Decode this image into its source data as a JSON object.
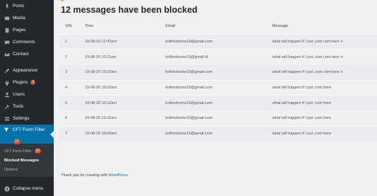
{
  "sidebar": {
    "items": [
      {
        "label": "Posts",
        "icon": "pin-icon"
      },
      {
        "label": "Media",
        "icon": "media-icon"
      },
      {
        "label": "Pages",
        "icon": "pages-icon"
      },
      {
        "label": "Comments",
        "icon": "comments-icon"
      },
      {
        "label": "Contact",
        "icon": "envelope-icon"
      },
      {
        "label": "Appearance",
        "icon": "paintbrush-icon"
      },
      {
        "label": "Plugins",
        "icon": "plugin-icon",
        "badge": "2"
      },
      {
        "label": "Users",
        "icon": "users-icon"
      },
      {
        "label": "Tools",
        "icon": "wrench-icon"
      },
      {
        "label": "Settings",
        "icon": "settings-icon"
      }
    ],
    "active": {
      "label": "CF7 Form Filter",
      "badge": "12",
      "icon": "cf7-icon"
    },
    "submenu": [
      {
        "label": "CF7 Form Filter",
        "badge": "12"
      },
      {
        "label": "Blocked Messages"
      },
      {
        "label": "Options"
      }
    ],
    "collapse_label": "Collapse menu"
  },
  "main": {
    "title": "12 messages have been blocked",
    "columns": [
      "S/N",
      "Time",
      "Email",
      "Message"
    ],
    "rows": [
      {
        "sn": "1",
        "time": "19-08-20 12:47pm",
        "email": "kofimokome10@gmail.com",
        "message": "what will happen if I put .com com here n"
      },
      {
        "sn": "2",
        "time": "19-08-20 10:11am",
        "email": "kofimokome10@gmail.tk",
        "message": "what will happen if I put .com com here n"
      },
      {
        "sn": "3",
        "time": "19-08-20 10:10am",
        "email": "kofimokome10@gmail.com",
        "message": "what will happen if I put .com com here n"
      },
      {
        "sn": "4",
        "time": "19-08-20 10:10am",
        "email": "kofimokome10@gmail.com",
        "message": "what will happen if I put .com here"
      },
      {
        "sn": "5",
        "time": "19-08-20 10:10am",
        "email": "kofimokome10@gmail.com",
        "message": "what will happen if I put .com here"
      },
      {
        "sn": "6",
        "time": "19-08-20 10:10am",
        "email": "kofimokome10@gmail.com",
        "message": "what will happen if I put .com here"
      },
      {
        "sn": "7",
        "time": "19-08-20 10:04am",
        "email": "kofimokome10@gmail.com",
        "message": "what will happen if I put .com here"
      }
    ],
    "footer_text": "Thank you for creating with ",
    "footer_link": "WordPress",
    "footer_end": "."
  },
  "colors": {
    "sidebar_bg": "#23282d",
    "accent": "#0073aa",
    "badge": "#d54e21"
  }
}
